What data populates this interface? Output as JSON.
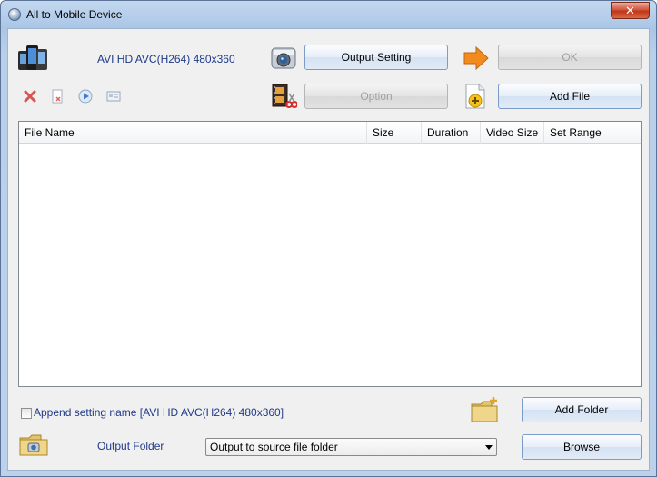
{
  "window": {
    "title": "All to Mobile Device",
    "close_label": "✕"
  },
  "toolbar": {
    "profile_text": "AVI HD AVC(H264) 480x360",
    "output_setting_label": "Output Setting",
    "ok_label": "OK",
    "option_label": "Option",
    "add_file_label": "Add File"
  },
  "icons": {
    "device": "phones-icon",
    "remove": "delete-x-icon",
    "clear": "clear-file-icon",
    "play": "play-icon",
    "properties": "properties-icon",
    "camera": "camera-setting-icon",
    "film": "film-cut-icon",
    "arrow": "orange-arrow-icon",
    "add_file": "add-file-icon",
    "add_folder": "add-folder-icon",
    "output_folder": "folder-camera-icon"
  },
  "file_list": {
    "columns": [
      "File Name",
      "Size",
      "Duration",
      "Video Size",
      "Set Range"
    ],
    "rows": []
  },
  "bottom": {
    "append_label": "Append setting name [AVI HD AVC(H264) 480x360]",
    "append_checked": false,
    "add_folder_label": "Add Folder",
    "output_folder_label": "Output Folder",
    "output_select_value": "Output to source file folder",
    "browse_label": "Browse"
  },
  "colors": {
    "accent_text": "#1f3a8a",
    "close_button": "#c23518",
    "arrow": "#f08a1c"
  }
}
